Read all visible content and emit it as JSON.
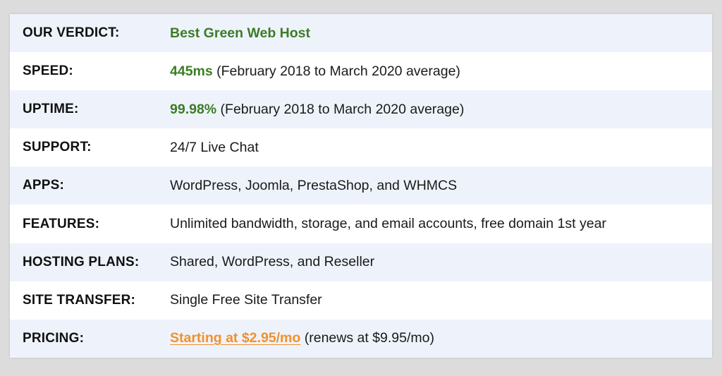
{
  "rows": [
    {
      "label": "OUR VERDICT:",
      "highlight": "Best Green Web Host",
      "text": ""
    },
    {
      "label": "SPEED:",
      "highlight": "445ms",
      "text": " (February 2018 to March 2020 average)"
    },
    {
      "label": "UPTIME:",
      "highlight": "99.98%",
      "text": " (February 2018 to March 2020 average)"
    },
    {
      "label": "SUPPORT:",
      "text": "24/7 Live Chat"
    },
    {
      "label": "APPS:",
      "text": "WordPress, Joomla, PrestaShop, and WHMCS"
    },
    {
      "label": "FEATURES:",
      "text": "Unlimited bandwidth, storage, and email accounts, free domain 1st year"
    },
    {
      "label": "HOSTING PLANS:",
      "text": "Shared, WordPress, and Reseller"
    },
    {
      "label": "SITE TRANSFER:",
      "text": "Single Free Site Transfer"
    },
    {
      "label": "PRICING:",
      "link": "Starting at $2.95/mo",
      "text": " (renews at $9.95/mo)"
    }
  ],
  "colors": {
    "highlight_green": "#3c7d25",
    "link_orange": "#f3902b",
    "row_shade": "#eef3fb"
  }
}
